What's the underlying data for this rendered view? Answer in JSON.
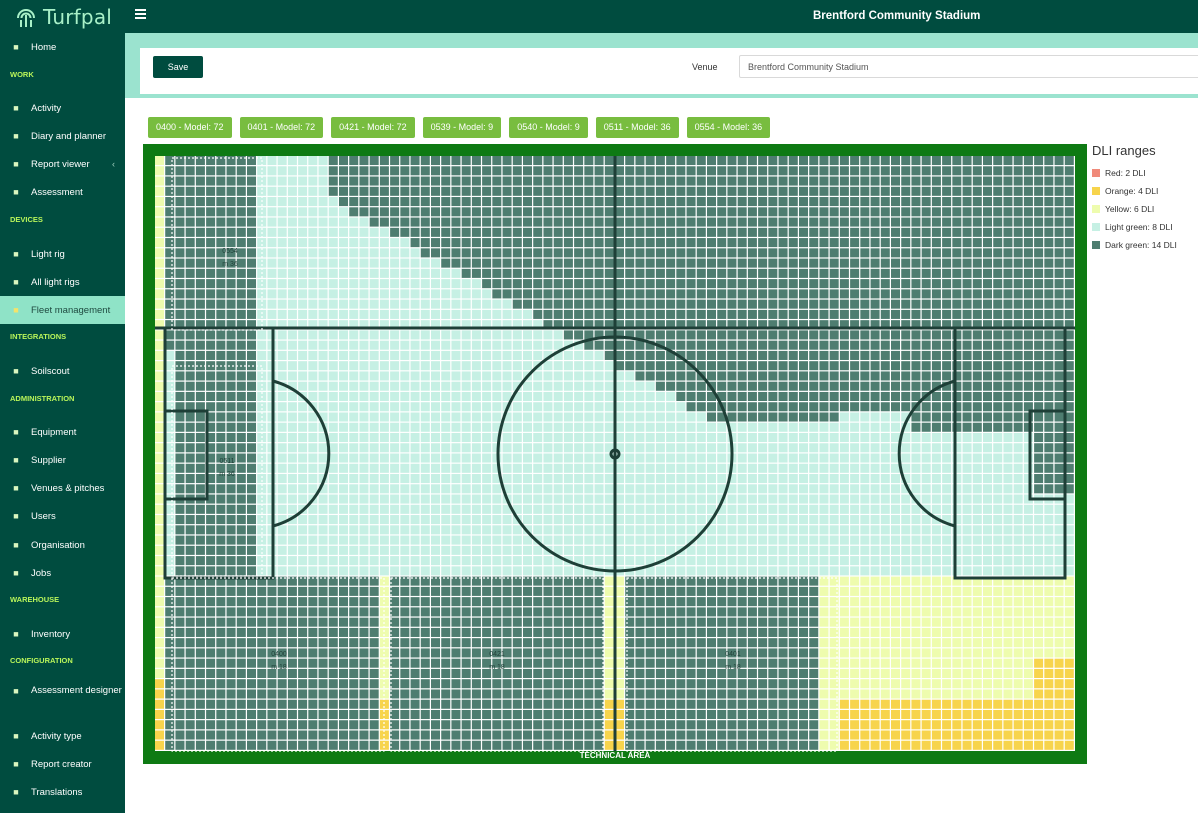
{
  "app": {
    "name": "Turfpal"
  },
  "header": {
    "title": "Brentford Community Stadium"
  },
  "sidebar": {
    "items": [
      {
        "label": "Home",
        "icon": "home-icon"
      },
      {
        "section": "WORK"
      },
      {
        "label": "Activity",
        "icon": "clipboard-icon"
      },
      {
        "label": "Diary and planner",
        "icon": "calendar-icon"
      },
      {
        "label": "Report viewer",
        "icon": "report-icon",
        "caret": "‹"
      },
      {
        "label": "Assessment",
        "icon": "gauge-icon"
      },
      {
        "section": "DEVICES"
      },
      {
        "label": "Light rig",
        "icon": "bulb-icon"
      },
      {
        "label": "All light rigs",
        "icon": "bulbs-icon"
      },
      {
        "label": "Fleet management",
        "icon": "pin-icon",
        "active": true
      },
      {
        "section": "INTEGRATIONS"
      },
      {
        "label": "Soilscout",
        "icon": "external-link-icon"
      },
      {
        "section": "ADMINISTRATION"
      },
      {
        "label": "Equipment",
        "icon": "tools-icon"
      },
      {
        "label": "Supplier",
        "icon": "supplier-icon"
      },
      {
        "label": "Venues & pitches",
        "icon": "venue-icon"
      },
      {
        "label": "Users",
        "icon": "users-icon"
      },
      {
        "label": "Organisation",
        "icon": "building-icon"
      },
      {
        "label": "Jobs",
        "icon": "jobs-icon"
      },
      {
        "section": "WAREHOUSE"
      },
      {
        "label": "Inventory",
        "icon": "inventory-icon"
      },
      {
        "section": "CONFIGURATION"
      },
      {
        "label": "Assessment designer",
        "icon": "designer-icon"
      },
      {
        "label": "Activity type",
        "icon": "activity-type-icon"
      },
      {
        "label": "Report creator",
        "icon": "report-creator-icon"
      },
      {
        "label": "Translations",
        "icon": "flag-icon"
      }
    ]
  },
  "toolbar": {
    "save_label": "Save",
    "venue_label": "Venue",
    "venue_value": "Brentford Community Stadium"
  },
  "rigs": [
    "0400 - Model: 72",
    "0401 - Model: 72",
    "0421 - Model: 72",
    "0539 - Model: 9",
    "0540 - Model: 9",
    "0511 - Model: 36",
    "0554 - Model: 36"
  ],
  "pitch": {
    "technical_area": "TECHNICAL AREA",
    "rig_labels": [
      {
        "name": "0554",
        "model": "m 36"
      },
      {
        "name": "0511",
        "model": "m 36"
      },
      {
        "name": "0400",
        "model": "m 18"
      },
      {
        "name": "0421",
        "model": "m 18"
      },
      {
        "name": "0401",
        "model": "m 18"
      }
    ]
  },
  "legend": {
    "title": "DLI ranges",
    "items": [
      {
        "label": "Red: 2 DLI",
        "color": "#f08a7a"
      },
      {
        "label": "Orange: 4 DLI",
        "color": "#f7d44c"
      },
      {
        "label": "Yellow: 6 DLI",
        "color": "#eefcae"
      },
      {
        "label": "Light green: 8 DLI",
        "color": "#c6f0e4"
      },
      {
        "label": "Dark green: 14 DLI",
        "color": "#4e7d70"
      }
    ]
  },
  "colors": {
    "brand": "#004c3f",
    "accent": "#9be3cf",
    "rig_tag": "#78bd3f",
    "pitch_border": "#0e7a13"
  }
}
